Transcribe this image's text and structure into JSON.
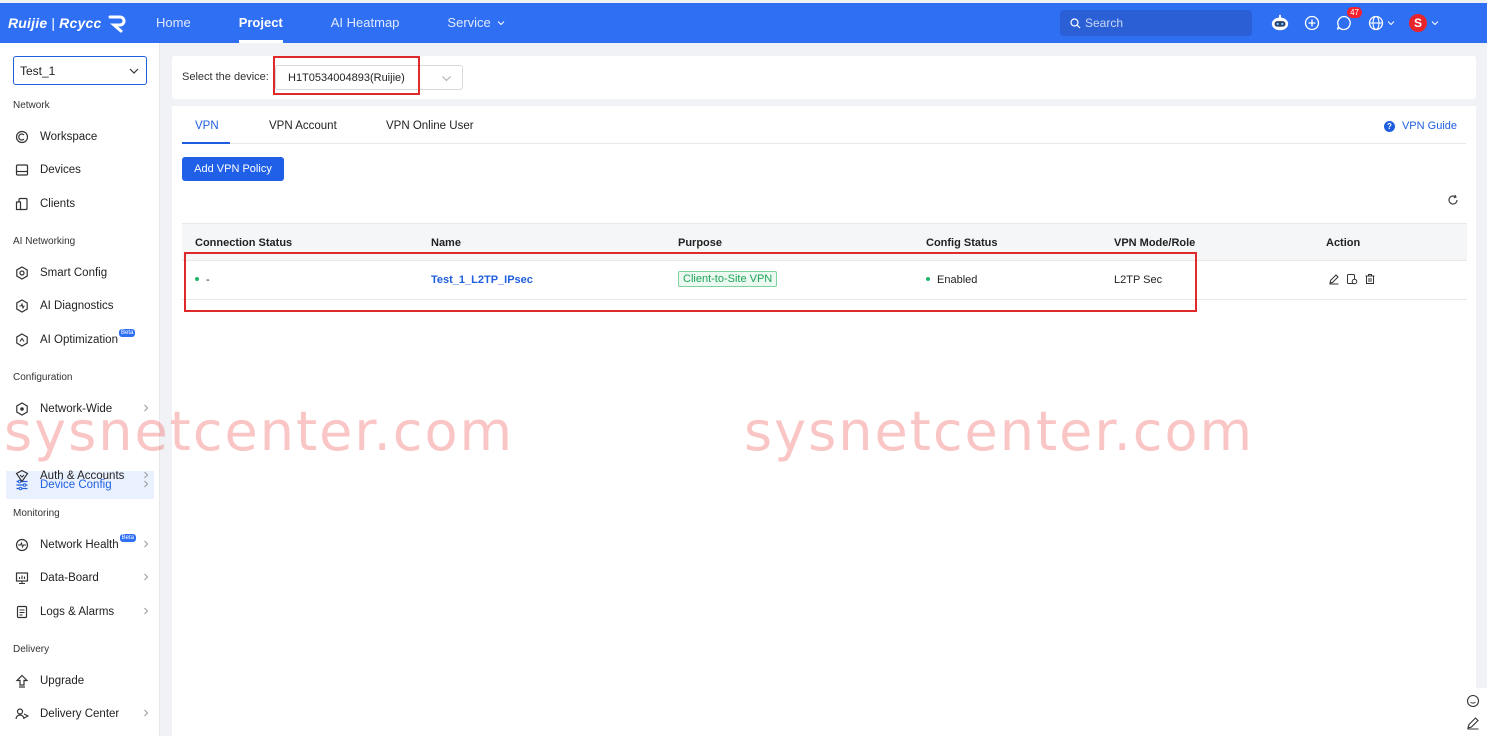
{
  "brand": {
    "logo_left": "Ruijie",
    "logo_sep": "|",
    "logo_right": "Rcycc"
  },
  "nav": {
    "home": "Home",
    "project": "Project",
    "heatmap": "AI Heatmap",
    "service": "Service"
  },
  "search": {
    "placeholder": "Search"
  },
  "notifications": {
    "count": "47"
  },
  "user": {
    "initial": "S"
  },
  "sidebar": {
    "project": "Test_1",
    "groups": {
      "network": "Network",
      "ai_networking": "AI Networking",
      "configuration": "Configuration",
      "monitoring": "Monitoring",
      "delivery": "Delivery"
    },
    "items": {
      "workspace": "Workspace",
      "devices": "Devices",
      "clients": "Clients",
      "smart_config": "Smart Config",
      "ai_diagnostics": "AI Diagnostics",
      "ai_optimization": "AI Optimization",
      "network_wide": "Network-Wide",
      "device_config": "Device Config",
      "auth_accounts": "Auth & Accounts",
      "network_health": "Network Health",
      "data_board": "Data-Board",
      "logs_alarms": "Logs & Alarms",
      "upgrade": "Upgrade",
      "delivery_center": "Delivery Center"
    },
    "beta_label": "Beta"
  },
  "device": {
    "label": "Select the device:",
    "value": "H1T0534004893(Ruijie)"
  },
  "tabs": {
    "vpn": "VPN",
    "vpn_account": "VPN Account",
    "vpn_online_user": "VPN Online User"
  },
  "guide": {
    "label": "VPN Guide"
  },
  "toolbar": {
    "add_label": "Add VPN Policy"
  },
  "table": {
    "headers": {
      "status": "Connection Status",
      "name": "Name",
      "purpose": "Purpose",
      "config": "Config Status",
      "mode": "VPN Mode/Role",
      "action": "Action"
    },
    "rows": [
      {
        "status": "-",
        "name": "Test_1_L2TP_IPsec",
        "purpose": "Client-to-Site VPN",
        "config": "Enabled",
        "mode": "L2TP Sec"
      }
    ]
  },
  "watermark": {
    "text": "sysnetcenter.com"
  },
  "colors": {
    "primary": "#2f6ff3",
    "accent": "#1f5fdf",
    "success": "#1eb867",
    "highlight": "#e02a2a"
  }
}
